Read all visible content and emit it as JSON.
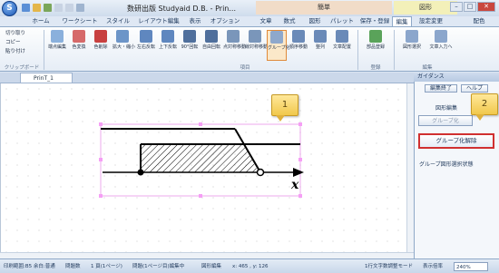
{
  "titlebar": {
    "app_title": "数研出版 Studyaid D.B. - Prin...",
    "ctx_center": "簡単",
    "ctx_right": "図形",
    "orb_label": "S"
  },
  "tabs": [
    {
      "label": "ホーム"
    },
    {
      "label": "ワークシート"
    },
    {
      "label": "スタイル"
    },
    {
      "label": "レイアウト編集"
    },
    {
      "label": "表示"
    },
    {
      "label": "オプション"
    },
    {
      "label": "文章"
    },
    {
      "label": "数式"
    },
    {
      "label": "図形"
    },
    {
      "label": "パレット"
    },
    {
      "label": "保存・登録"
    },
    {
      "label": "編集"
    },
    {
      "label": "設定変更"
    },
    {
      "label": "配色"
    }
  ],
  "clipboard": {
    "cut": "切り取り",
    "copy": "コピー",
    "paste": "貼り付け",
    "group": "クリップボード"
  },
  "ribbon": {
    "buttons": [
      {
        "label": "端点編集"
      },
      {
        "label": "色変換"
      },
      {
        "label": "色削除"
      },
      {
        "label": "拡大・縮小"
      },
      {
        "label": "左右反転"
      },
      {
        "label": "上下反転"
      },
      {
        "label": "90°回転"
      },
      {
        "label": "自由回転"
      },
      {
        "label": "点対称移動"
      },
      {
        "label": "線対称移動"
      },
      {
        "label": "グループ化"
      },
      {
        "label": "順序移動"
      },
      {
        "label": "整列"
      },
      {
        "label": "文章配置"
      },
      {
        "label": "部品登録"
      },
      {
        "label": "図形選択"
      },
      {
        "label": "文章入力へ"
      }
    ],
    "groups": {
      "item": "項目",
      "register": "登録",
      "edit": "編集"
    }
  },
  "document": {
    "tab_name": "PrinT_1",
    "x_label": "x"
  },
  "pane": {
    "title": "ガイダンス",
    "btn_finish": "編集終了",
    "btn_help": "ヘルプ",
    "edit_label": "図形編集",
    "group_btn": "グループ化",
    "ungroup_btn": "グループ化解除",
    "status_text": "グループ図形選択状態"
  },
  "callouts": {
    "one": "1",
    "two": "2"
  },
  "status": {
    "s1": "印刷範囲:B5 余白:普通",
    "s2": "問題数",
    "s3": "1 頁(1ページ)",
    "s4": "問題(1ページ目)編集中",
    "s5": "図形編集",
    "s6": "x: 465 , y: 126",
    "s7": "1行文字数調整モード",
    "zoom_label": "表示倍率",
    "zoom_value": "240%"
  },
  "colors": {
    "accent": "#d03030",
    "callout": "#f1c84c"
  }
}
